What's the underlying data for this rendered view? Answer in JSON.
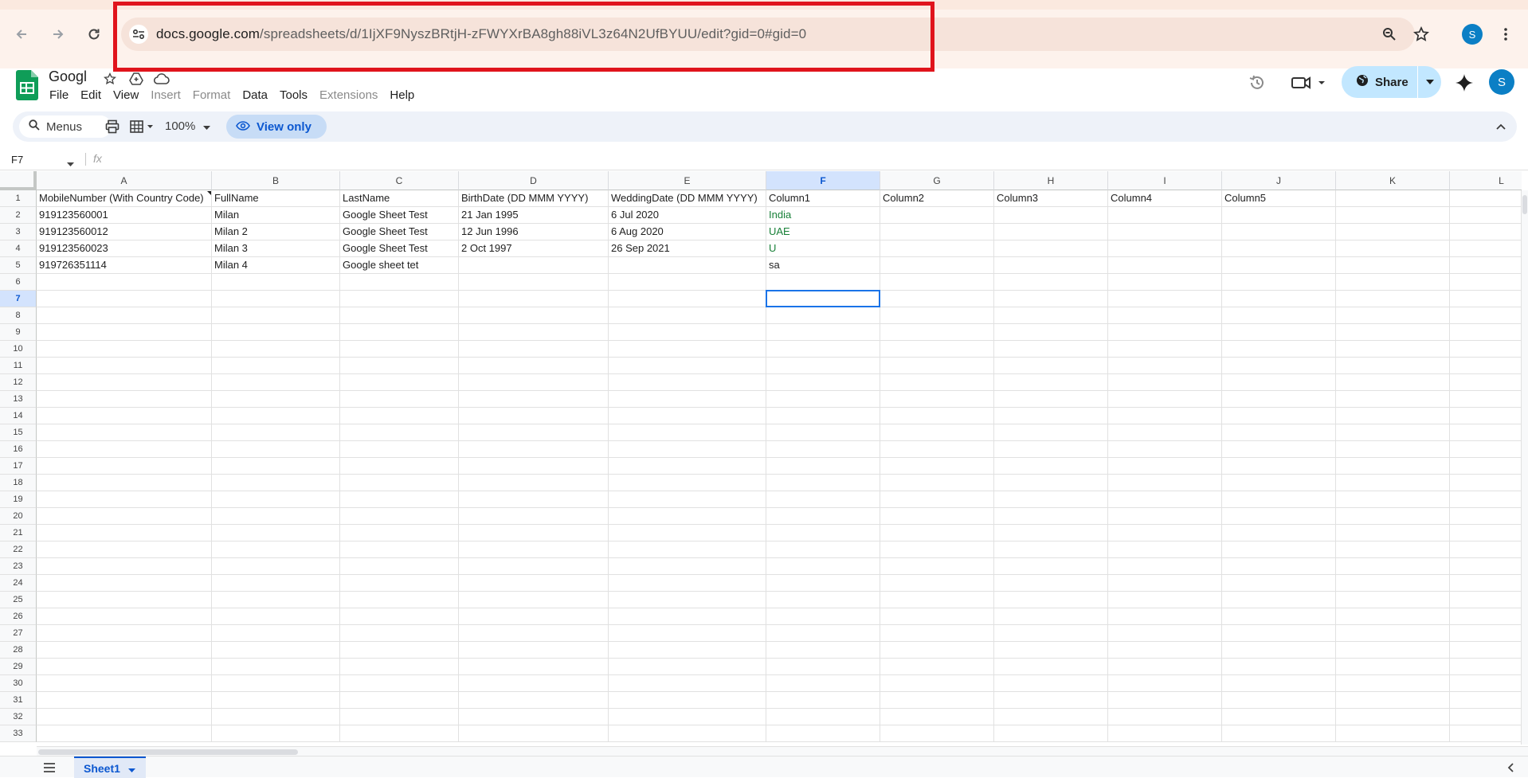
{
  "browser": {
    "url_host": "docs.google.com",
    "url_path": "/spreadsheets/d/1IjXF9NyszBRtjH-zFWYXrBA8gh88iVL3z64N2UfBYUU/edit?gid=0#gid=0",
    "profile_initial": "S",
    "icons": [
      "back-icon",
      "forward-icon",
      "reload-icon",
      "site-settings-icon",
      "zoom-icon",
      "bookmark-star-icon",
      "kebab-menu-icon"
    ]
  },
  "document": {
    "title": "Googl",
    "menus": [
      "File",
      "Edit",
      "View",
      "Insert",
      "Format",
      "Data",
      "Tools",
      "Extensions",
      "Help"
    ],
    "disabled_menus": [
      "Insert",
      "Format",
      "Extensions"
    ],
    "share_label": "Share",
    "avatar_initial": "S"
  },
  "toolbar": {
    "search_label": "Menus",
    "zoom": "100%",
    "view_only_label": "View only"
  },
  "formula_bar": {
    "name_box": "F7",
    "fx_label": "fx"
  },
  "grid": {
    "columns": [
      "A",
      "B",
      "C",
      "D",
      "E",
      "F",
      "G",
      "H",
      "I",
      "J",
      "K",
      "L"
    ],
    "selected_column": "F",
    "selected_row": 7,
    "row_count": 33,
    "rows": [
      [
        "MobileNumber (With Country Code)",
        "FullName",
        "LastName",
        "BirthDate (DD MMM YYYY)",
        "WeddingDate (DD MMM YYYY)",
        "Column1",
        "Column2",
        "Column3",
        "Column4",
        "Column5",
        "",
        ""
      ],
      [
        "919123560001",
        "Milan",
        "Google Sheet Test",
        "21 Jan 1995",
        "6 Jul 2020",
        "India",
        "",
        "",
        "",
        "",
        "",
        ""
      ],
      [
        "919123560012",
        "Milan 2",
        "Google Sheet Test",
        "12 Jun 1996",
        "6 Aug 2020",
        "UAE",
        "",
        "",
        "",
        "",
        "",
        ""
      ],
      [
        "919123560023",
        "Milan 3",
        "Google Sheet Test",
        "2 Oct 1997",
        "26 Sep 2021",
        "U",
        "",
        "",
        "",
        "",
        "",
        ""
      ],
      [
        "919726351114",
        "Milan 4",
        "Google sheet tet",
        "",
        "",
        "sa",
        "",
        "",
        "",
        "",
        "",
        ""
      ]
    ],
    "green_text_cells": [
      "F2",
      "F3",
      "F4"
    ],
    "green_color": "#188038"
  },
  "sheets": {
    "active": "Sheet1"
  },
  "colors": {
    "accent": "#0b57d0",
    "share_bg": "#c2e7ff",
    "highlight_box": "#e0141c",
    "sheets_green": "#0f9d58"
  }
}
